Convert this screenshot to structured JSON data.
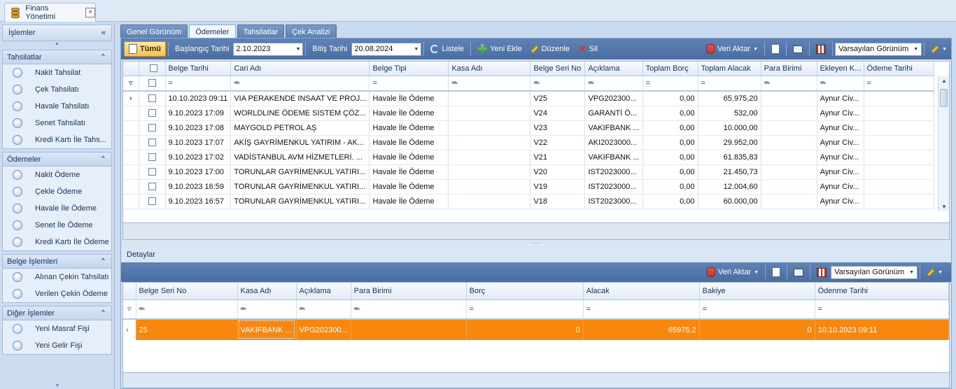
{
  "doc_tab": {
    "title": "Finans Yönetimi",
    "close": "×"
  },
  "left_panel": {
    "header": "İşlemler",
    "collapse": "«",
    "groups": [
      {
        "title": "Tahsilatlar",
        "toggle": "⌃",
        "items": [
          "Nakit Tahsilat",
          "Çek Tahsilatı",
          "Havale Tahsilatı",
          "Senet Tahsilatı",
          "Kredi Kartı İle Tahs..."
        ]
      },
      {
        "title": "Ödemeler",
        "toggle": "⌃",
        "items": [
          "Nakit Ödeme",
          "Çekle Ödeme",
          "Havale İle Ödeme",
          "Senet İle Ödeme",
          "Kredi Kartı İle Ödeme"
        ]
      },
      {
        "title": "Belge İşlemleri",
        "toggle": "⌃",
        "items": [
          "Alınan Çekin Tahsilatı",
          "Verilen Çekin Ödeme"
        ]
      },
      {
        "title": "Diğer İşlemler",
        "toggle": "⌃",
        "items": [
          "Yeni Masraf Fişi",
          "Yeni Gelir Fişi"
        ]
      }
    ]
  },
  "tabs": [
    "Genel Görünüm",
    "Ödemeler",
    "Tahsilatlar",
    "Çek Analizi"
  ],
  "active_tab": 1,
  "toolbar": {
    "all": "Tümü",
    "start_label": "Başlangıç Tarihi",
    "start_value": "2.10.2023",
    "end_label": "Bitiş Tarihi",
    "end_value": "20.08.2024",
    "list": "Listele",
    "add": "Yeni Ekle",
    "edit": "Düzenle",
    "delete": "Sil",
    "export": "Veri Aktar",
    "view": "Varsayılan Görünüm"
  },
  "grid": {
    "columns": [
      "Belge Tarihi",
      "Cari Adı",
      "Belge Tipi",
      "Kasa Adı",
      "Belge Seri No",
      "Açıklama",
      "Toplam Borç",
      "Toplam Alacak",
      "Para Birimi",
      "Ekleyen K...",
      "Ödeme Tarihi"
    ],
    "filters": [
      "=",
      "abc",
      "=",
      "abc",
      "abc",
      "abc",
      "=",
      "=",
      "abc",
      "abc",
      "="
    ],
    "rows": [
      [
        "10.10.2023 09:11",
        "VIA PERAKENDE INSAAT VE PROJ...",
        "Havale İle Ödeme",
        "",
        "V25",
        "VPG202300...",
        "0,00",
        "65.975,20",
        "",
        "Aynur Civ...",
        ""
      ],
      [
        "9.10.2023 17:09",
        "WORLDLINE ÖDEME SİSTEM ÇÖZ...",
        "Havale İle Ödeme",
        "",
        "V24",
        "GARANTİ Ö...",
        "0,00",
        "532,00",
        "",
        "Aynur Civ...",
        ""
      ],
      [
        "9.10.2023 17:08",
        "MAYGOLD PETROL AŞ",
        "Havale İle Ödeme",
        "",
        "V23",
        "VAKIFBANK ...",
        "0,00",
        "10.000,00",
        "",
        "Aynur Civ...",
        ""
      ],
      [
        "9.10.2023 17:07",
        "AKİŞ GAYRİMENKUL YATIRIM - AK...",
        "Havale İle Ödeme",
        "",
        "V22",
        "AKI2023000...",
        "0,00",
        "29.952,00",
        "",
        "Aynur Civ...",
        ""
      ],
      [
        "9.10.2023 17:02",
        "VADİSTANBUL AVM HİZMETLERİ. ...",
        "Havale İle Ödeme",
        "",
        "V21",
        "VAKIFBANK ...",
        "0,00",
        "61.835,83",
        "",
        "Aynur Civ...",
        ""
      ],
      [
        "9.10.2023 17:00",
        "TORUNLAR GAYRİMENKUL YATIRI...",
        "Havale İle Ödeme",
        "",
        "V20",
        "IST2023000...",
        "0,00",
        "21.450,73",
        "",
        "Aynur Civ...",
        ""
      ],
      [
        "9.10.2023 16:59",
        "TORUNLAR GAYRİMENKUL YATIRI...",
        "Havale İle Ödeme",
        "",
        "V19",
        "IST2023000...",
        "0,00",
        "12.004,60",
        "",
        "Aynur Civ...",
        ""
      ],
      [
        "9.10.2023 16:57",
        "TORUNLAR GAYRİMENKUL YATIRI...",
        "Havale İle Ödeme",
        "",
        "V18",
        "IST2023000...",
        "0,00",
        "60.000,00",
        "",
        "Aynur Civ...",
        ""
      ]
    ]
  },
  "details": {
    "label": "Detaylar",
    "export": "Veri Aktar",
    "view": "Varsayılan Görünüm",
    "columns": [
      "Belge Seri No",
      "Kasa Adı",
      "Açıklama",
      "Para Birimi",
      "Borç",
      "Alacak",
      "Bakiye",
      "Ödenme Tarihi"
    ],
    "filters": [
      "abc",
      "abc",
      "abc",
      "abc",
      "=",
      "=",
      "=",
      "="
    ],
    "rows": [
      [
        "25",
        "VAKIFBANK ...",
        "VPG202300...",
        "",
        "0",
        "65975,2",
        "0",
        "10.10.2023 09:11"
      ]
    ]
  },
  "colors": {
    "accent": "#4a6ea2",
    "selected_row": "#f7870f"
  }
}
